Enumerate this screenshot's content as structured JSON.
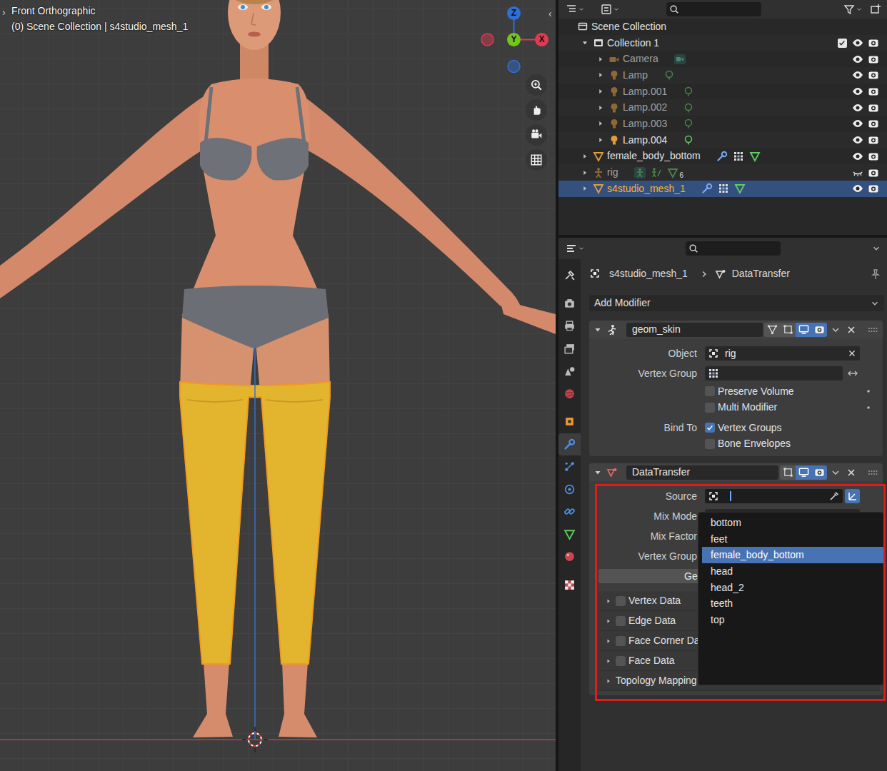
{
  "viewport": {
    "toolbar_toggle": "›",
    "sidebar_toggle": "‹",
    "view_name": "Front Orthographic",
    "context": "(0) Scene Collection | s4studio_mesh_1",
    "gizmo": [
      {
        "label": "Z",
        "color": "#2f6fd8"
      },
      {
        "label": "Y",
        "color": "#74c41c"
      },
      {
        "label": "X",
        "color": "#e23a52"
      }
    ],
    "nav_buttons": [
      {
        "kind": "zoom"
      },
      {
        "kind": "pan"
      },
      {
        "kind": "camera"
      },
      {
        "kind": "grid"
      }
    ]
  },
  "outliner": {
    "root": "Scene Collection",
    "collection": {
      "label": "Collection 1",
      "expanded": true,
      "checked": true,
      "visible": true,
      "children": [
        {
          "label": "Camera",
          "kind": "camera",
          "dimmed": true,
          "expanded": false,
          "selected": false,
          "visible": true
        },
        {
          "label": "Lamp",
          "kind": "lamp",
          "dimmed": true,
          "expanded": false,
          "selected": false,
          "visible": true
        },
        {
          "label": "Lamp.001",
          "kind": "lamp",
          "dimmed": true,
          "expanded": false,
          "selected": false,
          "visible": true
        },
        {
          "label": "Lamp.002",
          "kind": "lamp",
          "dimmed": true,
          "expanded": false,
          "selected": false,
          "visible": true
        },
        {
          "label": "Lamp.003",
          "kind": "lamp",
          "dimmed": true,
          "expanded": false,
          "selected": false,
          "visible": true
        },
        {
          "label": "Lamp.004",
          "kind": "lamp",
          "dimmed": false,
          "expanded": false,
          "selected": false,
          "visible": true
        }
      ]
    },
    "objects": [
      {
        "label": "female_body_bottom",
        "kind": "mesh",
        "dimmed": false,
        "expanded": false,
        "selected": false,
        "visible": true
      },
      {
        "label": "rig",
        "kind": "armature",
        "dimmed": true,
        "expanded": false,
        "selected": false,
        "visible": false,
        "count": "6"
      },
      {
        "label": "s4studio_mesh_1",
        "kind": "mesh",
        "dimmed": false,
        "expanded": false,
        "selected": true,
        "visible": true
      }
    ]
  },
  "properties": {
    "tabs": [
      {
        "kind": "tool",
        "selected": false
      },
      {
        "kind": "render",
        "selected": false
      },
      {
        "kind": "output",
        "selected": false
      },
      {
        "kind": "view",
        "selected": false
      },
      {
        "kind": "scene",
        "selected": false
      },
      {
        "kind": "world",
        "selected": false
      },
      {
        "kind": "object",
        "selected": false
      },
      {
        "kind": "modifier",
        "selected": true
      },
      {
        "kind": "particles",
        "selected": false
      },
      {
        "kind": "physics",
        "selected": false
      },
      {
        "kind": "constraints",
        "selected": false
      },
      {
        "kind": "data",
        "selected": false
      },
      {
        "kind": "material",
        "selected": false
      },
      {
        "kind": "texture",
        "selected": false
      }
    ],
    "breadcrumb": [
      "s4studio_mesh_1",
      "DataTransfer"
    ],
    "add_modifier": "Add Modifier",
    "modifiers": [
      {
        "kind": "armature",
        "name": "geom_skin",
        "expanded": true,
        "toggles": [
          {
            "kind": "cage",
            "on": false
          },
          {
            "kind": "editmode",
            "on": false
          },
          {
            "kind": "realtime",
            "on": true
          },
          {
            "kind": "render",
            "on": true
          }
        ],
        "fields": [
          {
            "kind": "object",
            "label": "Object",
            "value": "rig",
            "focused": false
          },
          {
            "kind": "vertex_group",
            "label": "Vertex Group",
            "value": "",
            "invert": false
          },
          {
            "kind": "check",
            "label": "",
            "text": "Preserve Volume",
            "checked": false,
            "animatable": true
          },
          {
            "kind": "check",
            "label": "",
            "text": "Multi Modifier",
            "checked": false,
            "animatable": true
          },
          {
            "kind": "check",
            "label": "Bind To",
            "text": "Vertex Groups",
            "checked": true,
            "animatable": false
          },
          {
            "kind": "check",
            "label": "",
            "text": "Bone Envelopes",
            "checked": false,
            "animatable": false
          }
        ],
        "subpanels": []
      },
      {
        "kind": "datatransfer",
        "name": "DataTransfer",
        "expanded": true,
        "toggles": [
          {
            "kind": "editmode",
            "on": false
          },
          {
            "kind": "realtime",
            "on": true
          },
          {
            "kind": "render",
            "on": true
          }
        ],
        "fields": [
          {
            "kind": "object",
            "label": "Source",
            "value": "",
            "focused": true,
            "object_transform": true
          },
          {
            "kind": "select",
            "label": "Mix Mode"
          },
          {
            "kind": "slider",
            "label": "Mix Factor"
          },
          {
            "kind": "vertex_group",
            "label": "Vertex Group",
            "value": "",
            "invert": false
          },
          {
            "kind": "button",
            "text": "Ge"
          }
        ],
        "subpanels": [
          {
            "kind": "toggle",
            "label": "Vertex Data",
            "checked": false,
            "expanded": false
          },
          {
            "kind": "toggle",
            "label": "Edge Data",
            "checked": false,
            "expanded": false
          },
          {
            "kind": "toggle",
            "label": "Face Corner Da",
            "checked": false,
            "expanded": false
          },
          {
            "kind": "toggle",
            "label": "Face Data",
            "checked": false,
            "expanded": false
          },
          {
            "kind": "plain",
            "label": "Topology Mapping",
            "expanded": false
          }
        ]
      }
    ],
    "source_menu": {
      "items": [
        {
          "label": "bottom",
          "selected": false
        },
        {
          "label": "feet",
          "selected": false
        },
        {
          "label": "female_body_bottom",
          "selected": true
        },
        {
          "label": "head",
          "selected": false
        },
        {
          "label": "head_2",
          "selected": false
        },
        {
          "label": "teeth",
          "selected": false
        },
        {
          "label": "top",
          "selected": false
        }
      ]
    }
  }
}
